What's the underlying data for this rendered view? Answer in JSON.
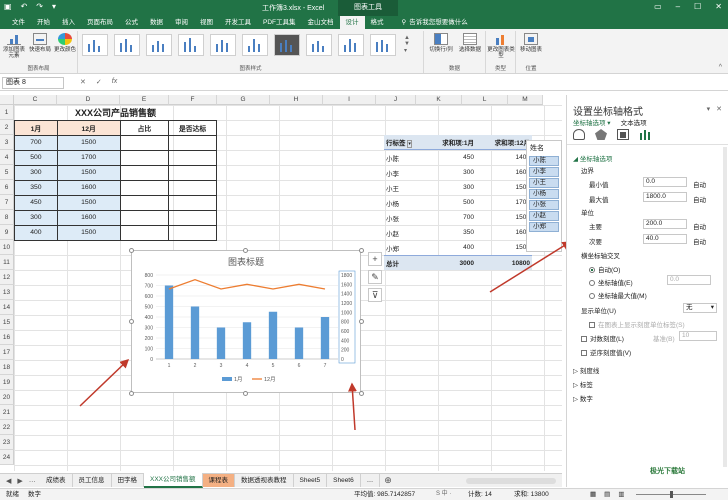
{
  "window": {
    "doc_title": "工作簿3.xlsx - Excel",
    "context_tab": "图表工具"
  },
  "tabs": [
    "文件",
    "开始",
    "插入",
    "页面布局",
    "公式",
    "数据",
    "审阅",
    "视图",
    "开发工具",
    "PDF工具集",
    "金山文档",
    "设计",
    "格式"
  ],
  "active_tab": "设计",
  "tell_me": "告诉我您想要做什么",
  "ribbon": {
    "btn_add_element": "添加图表元素",
    "btn_quick_layout": "快速布局",
    "btn_change_colors": "更改颜色",
    "group_layout": "图表布局",
    "group_styles": "图表样式",
    "btn_switch": "切换行/列",
    "btn_select_data": "选择数据",
    "group_data": "数据",
    "btn_change_type": "更改图表类型",
    "group_type": "类型",
    "btn_move": "移动图表",
    "group_location": "位置"
  },
  "formula_bar": {
    "name_box": "图表 8",
    "fx": "fx"
  },
  "columns": [
    "C",
    "D",
    "E",
    "F",
    "G",
    "H",
    "I",
    "J",
    "K",
    "L",
    "M"
  ],
  "rows": [
    "1",
    "2",
    "3",
    "4",
    "5",
    "6",
    "7",
    "8",
    "9",
    "10",
    "11",
    "12",
    "13",
    "14",
    "15",
    "16",
    "17",
    "18",
    "19",
    "20",
    "21",
    "22",
    "23",
    "24"
  ],
  "table": {
    "title": "XXX公司产品销售额",
    "headers": [
      "1月",
      "12月",
      "占比",
      "是否达标"
    ],
    "rows": [
      [
        "700",
        "1500"
      ],
      [
        "500",
        "1700"
      ],
      [
        "300",
        "1500"
      ],
      [
        "350",
        "1600"
      ],
      [
        "450",
        "1500"
      ],
      [
        "300",
        "1600"
      ],
      [
        "400",
        "1500"
      ]
    ]
  },
  "pivot": {
    "headers": [
      "行标签",
      "求和项:1月",
      "求和项:12月"
    ],
    "rows": [
      [
        "小陈",
        "450",
        "1400"
      ],
      [
        "小李",
        "300",
        "1600"
      ],
      [
        "小王",
        "300",
        "1500"
      ],
      [
        "小杨",
        "500",
        "1700"
      ],
      [
        "小张",
        "700",
        "1500"
      ],
      [
        "小赵",
        "350",
        "1600"
      ],
      [
        "小郑",
        "400",
        "1500"
      ]
    ],
    "total": [
      "总计",
      "3000",
      "10800"
    ]
  },
  "slicer": {
    "title": "姓名",
    "items": [
      "小陈",
      "小李",
      "小王",
      "小杨",
      "小张",
      "小赵",
      "小郑"
    ]
  },
  "chart_data": {
    "type": "bar",
    "title": "图表标题",
    "categories": [
      "1",
      "2",
      "3",
      "4",
      "5",
      "6",
      "7"
    ],
    "series": [
      {
        "name": "1月",
        "kind": "bar",
        "axis": "primary",
        "values": [
          700,
          500,
          300,
          350,
          450,
          300,
          400
        ]
      },
      {
        "name": "12月",
        "kind": "line",
        "axis": "secondary",
        "values": [
          1500,
          1700,
          1500,
          1600,
          1500,
          1600,
          1500
        ]
      }
    ],
    "ylim": [
      0,
      800
    ],
    "y_ticks": [
      "0",
      "100",
      "200",
      "300",
      "400",
      "500",
      "600",
      "700",
      "800"
    ],
    "y2lim": [
      0,
      1800
    ],
    "y2_ticks": [
      "0",
      "200",
      "400",
      "600",
      "800",
      "1000",
      "1200",
      "1400",
      "1600",
      "1800"
    ],
    "grid": true,
    "legend": "bottom",
    "colors": {
      "bar": "#5b9bd5",
      "line": "#ed7d31"
    }
  },
  "sheets": [
    "成绩表",
    "员工信息",
    "田字格",
    "XXX公司销售额",
    "课程表",
    "数据透视表教程",
    "Sheet5",
    "Sheet6"
  ],
  "active_sheet": "XXX公司销售额",
  "status": {
    "left1": "就绪",
    "left2": "数字",
    "average": "平均值: 985.7142857",
    "count": "计数: 14",
    "sum": "求和: 13800"
  },
  "pane": {
    "title": "设置坐标轴格式",
    "sub_axis": "坐标轴选项",
    "sub_text": "文本选项",
    "section": "坐标轴选项",
    "bounds": "边界",
    "min_label": "最小值",
    "min_value": "0.0",
    "max_label": "最大值",
    "max_value": "1800.0",
    "auto": "自动",
    "units": "单位",
    "major_label": "主要",
    "major_value": "200.0",
    "minor_label": "次要",
    "minor_value": "40.0",
    "cross": "横坐标轴交叉",
    "cross_auto": "自动(O)",
    "cross_value": "坐标轴值(E)",
    "cross_value_num": "0.0",
    "cross_max": "坐标轴最大值(M)",
    "display_units": "显示单位(U)",
    "display_units_value": "无",
    "show_units_label": "在图表上显示刻度单位标签(S)",
    "log_scale": "对数刻度(L)",
    "log_base_label": "基准(B)",
    "log_base": "10",
    "reverse": "逆序刻度值(V)",
    "tick_marks": "刻度线",
    "labels": "标签",
    "number": "数字"
  },
  "watermark": "极光下载站"
}
